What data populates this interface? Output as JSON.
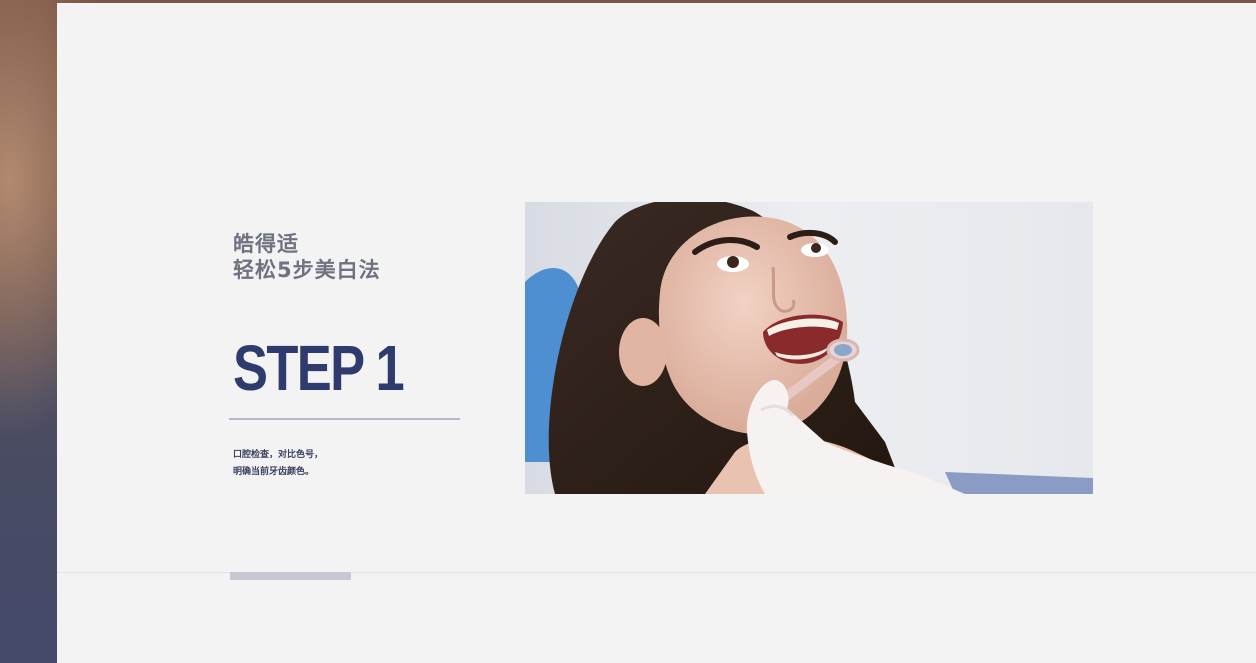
{
  "slide": {
    "title_line1": "皓得适",
    "title_line2": "轻松5步美白法",
    "step_label": "STEP 1",
    "desc_line1": "口腔检查，对比色号，",
    "desc_line2": "明确当前牙齿颜色。",
    "progress_fraction": 0.2
  },
  "colors": {
    "slide_bg": "#f3f3f4",
    "title_text": "#6f7380",
    "step_text": "#2e3b6c",
    "divider": "#b7b9c9",
    "progress_bar": "#c6c8d3"
  }
}
